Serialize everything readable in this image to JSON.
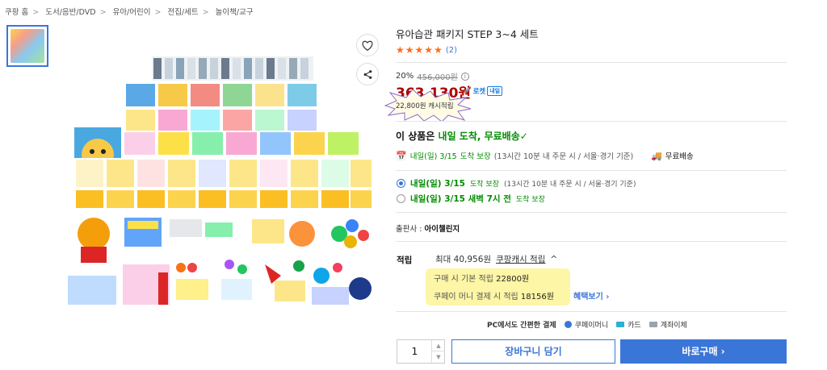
{
  "breadcrumb": [
    "쿠팡 홈",
    "도서/음반/DVD",
    "유아/어린이",
    "전집/세트",
    "놀이책/교구"
  ],
  "product": {
    "title": "유아습관 패키지 STEP 3~4 세트",
    "rating_stars": 5,
    "review_count": "(2)",
    "discount_rate": "20%",
    "original_price": "456,000원",
    "info_icon": "info-icon",
    "price": "363,130원",
    "rocket_label": "로켓",
    "rocket_badge": "내일",
    "cash_back": "22,800원 캐시적립",
    "arrival_prefix": "이 상품은 ",
    "arrival_highlight": "내일 도착, 무료배송",
    "arrival_check": "✓"
  },
  "shipping": {
    "main_day": "내일(일) 3/15",
    "main_guarantee": "도착 보장",
    "main_note": "(13시간 10분 내 주문 시 / 서울·경기 기준)",
    "free_shipping": "무료배송"
  },
  "options": [
    {
      "day": "내일(일) 3/15",
      "guarantee": "도착 보장",
      "note": "(13시간 10분 내 주문 시 / 서울·경기 기준)",
      "checked": true
    },
    {
      "day": "내일(일) 3/15 새벽 7시 전",
      "guarantee": "도착 보장",
      "note": "",
      "checked": false
    }
  ],
  "publisher": {
    "label": "출판사 : ",
    "name": "아이챌린지"
  },
  "points": {
    "label": "적립",
    "max": "최대 40,956원",
    "link": "쿠팡캐시 적립",
    "chevron": "^",
    "line1_label": "구매 시 기본 적립",
    "line1_value": "22800원",
    "line2_label": "쿠페이 머니 결제 시 적립",
    "line2_value": "18156원",
    "benefit": "혜택보기 ›"
  },
  "payment": {
    "prefix": "PC에서도 간편한 결제",
    "methods": [
      "쿠페이머니",
      "카드",
      "계좌이체"
    ]
  },
  "purchase": {
    "quantity": "1",
    "cart_label": "장바구니 담기",
    "buy_label": "바로구매 ›"
  },
  "colors": {
    "accent": "#3a76d8",
    "price": "#ae0000",
    "star": "#ff6b1a",
    "green": "#008c00",
    "highlight": "#fdf6a6"
  }
}
